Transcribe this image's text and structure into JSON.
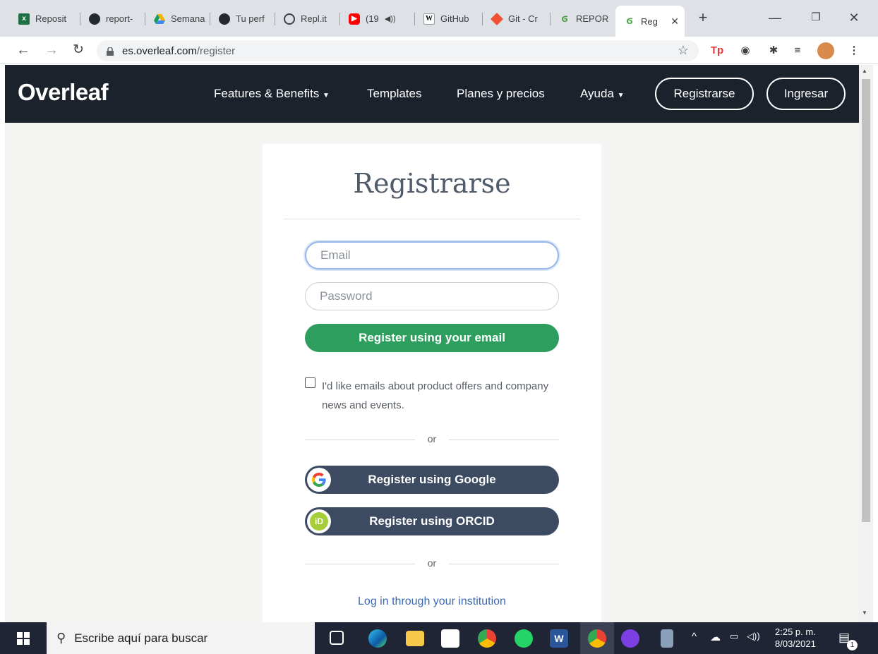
{
  "browser": {
    "tabs": [
      {
        "label": "Reposit",
        "icon": "excel-icon",
        "color": "#1e7145",
        "glyph": "x"
      },
      {
        "label": "report-",
        "icon": "github-icon",
        "color": "#24292e",
        "glyph": ""
      },
      {
        "label": "Semana",
        "icon": "google-drive-icon",
        "color": "#f4b400",
        "glyph": ""
      },
      {
        "label": "Tu perf",
        "icon": "github-icon",
        "color": "#24292e",
        "glyph": ""
      },
      {
        "label": "Repl.it",
        "icon": "replit-icon",
        "color": "#3c4043",
        "glyph": ""
      },
      {
        "label": "(19",
        "icon": "youtube-icon",
        "color": "#ff0000",
        "glyph": ""
      },
      {
        "label": "GitHub",
        "icon": "wikipedia-icon",
        "color": "#ffffff",
        "glyph": "W"
      },
      {
        "label": "Git - Cr",
        "icon": "git-icon",
        "color": "#f05033",
        "glyph": ""
      },
      {
        "label": "REPOR",
        "icon": "overleaf-icon",
        "color": "#47a141",
        "glyph": ""
      },
      {
        "label": "Reg",
        "icon": "overleaf-icon",
        "color": "#47a141",
        "glyph": ""
      }
    ],
    "url_host": "es.overleaf.com",
    "url_path": "/register"
  },
  "navbar": {
    "logo": "Overleaf",
    "features": "Features & Benefits",
    "templates": "Templates",
    "plans": "Planes y precios",
    "help": "Ayuda",
    "register": "Registrarse",
    "login": "Ingresar"
  },
  "form": {
    "title": "Registrarse",
    "email_placeholder": "Email",
    "password_placeholder": "Password",
    "register_email": "Register using your email",
    "checkbox_label": "I'd like emails about product offers and company news and events.",
    "or1": "or",
    "google": "Register using Google",
    "orcid": "Register using ORCID",
    "or2": "or",
    "institution": "Log in through your institution"
  },
  "taskbar": {
    "search_placeholder": "Escribe aquí para buscar",
    "time": "2:25 p. m.",
    "date": "8/03/2021",
    "notifications": "1"
  }
}
